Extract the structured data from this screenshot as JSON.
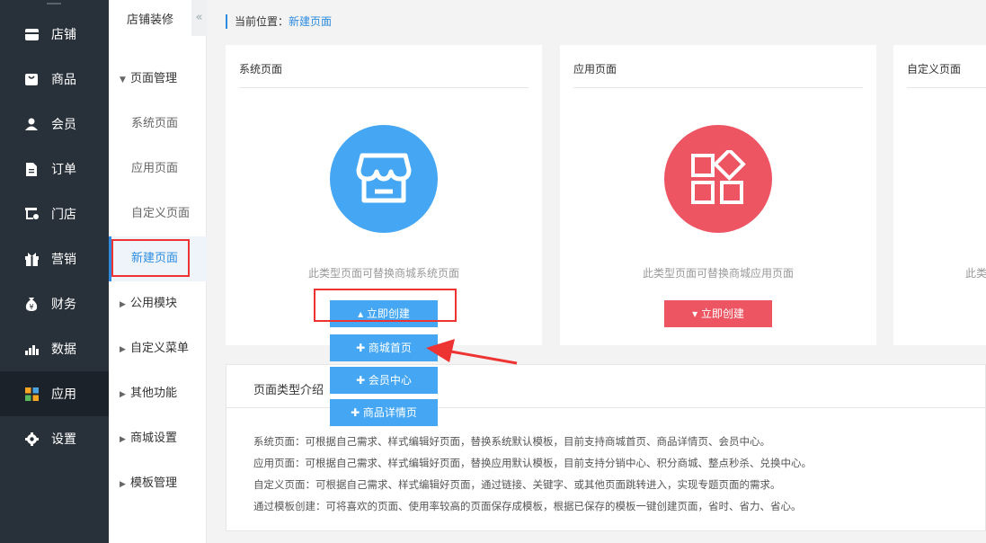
{
  "nav": {
    "items": [
      {
        "label": "店铺",
        "icon": "store-icon"
      },
      {
        "label": "商品",
        "icon": "bag-icon"
      },
      {
        "label": "会员",
        "icon": "user-icon"
      },
      {
        "label": "订单",
        "icon": "order-icon"
      },
      {
        "label": "门店",
        "icon": "shop-icon"
      },
      {
        "label": "营销",
        "icon": "gift-icon"
      },
      {
        "label": "财务",
        "icon": "money-bag-icon"
      },
      {
        "label": "数据",
        "icon": "bar-chart-icon"
      },
      {
        "label": "应用",
        "icon": "apps-icon"
      },
      {
        "label": "设置",
        "icon": "gear-icon"
      }
    ],
    "active": "应用"
  },
  "sub": {
    "title": "店铺装修",
    "collapse": "«",
    "page_mgmt": "页面管理",
    "page_items": [
      "系统页面",
      "应用页面",
      "自定义页面",
      "新建页面"
    ],
    "groups": [
      "公用模块",
      "自定义菜单",
      "其他功能",
      "商城设置",
      "模板管理"
    ]
  },
  "crumb": {
    "prefix": "当前位置：",
    "current": "新建页面"
  },
  "cards": [
    {
      "title": "系统页面",
      "desc": "此类型页面可替换商城系统页面",
      "button": "▴ 立即创建",
      "color": "#45a7f3"
    },
    {
      "title": "应用页面",
      "desc": "此类型页面可替换商城应用页面",
      "button": "▾ 立即创建",
      "color": "#ee5563"
    },
    {
      "title": "自定义页面",
      "desc": "此类",
      "button": "",
      "color": "#f0a33a"
    }
  ],
  "dropdown": [
    "✚ 商城首页",
    "✚ 会员中心",
    "✚ 商品详情页"
  ],
  "intro": {
    "title": "页面类型介绍",
    "lines": [
      "系统页面：可根据自己需求、样式编辑好页面，替换系统默认模板，目前支持商城首页、商品详情页、会员中心。",
      "应用页面：可根据自己需求、样式编辑好页面，替换应用默认模板，目前支持分销中心、积分商城、整点秒杀、兑换中心。",
      "自定义页面：可根据自己需求、样式编辑好页面，通过链接、关键字、或其他页面跳转进入，实现专题页面的需求。",
      "通过模板创建：可将喜欢的页面、使用率较高的页面保存成模板，根据已保存的模板一键创建页面，省时、省力、省心。"
    ]
  }
}
